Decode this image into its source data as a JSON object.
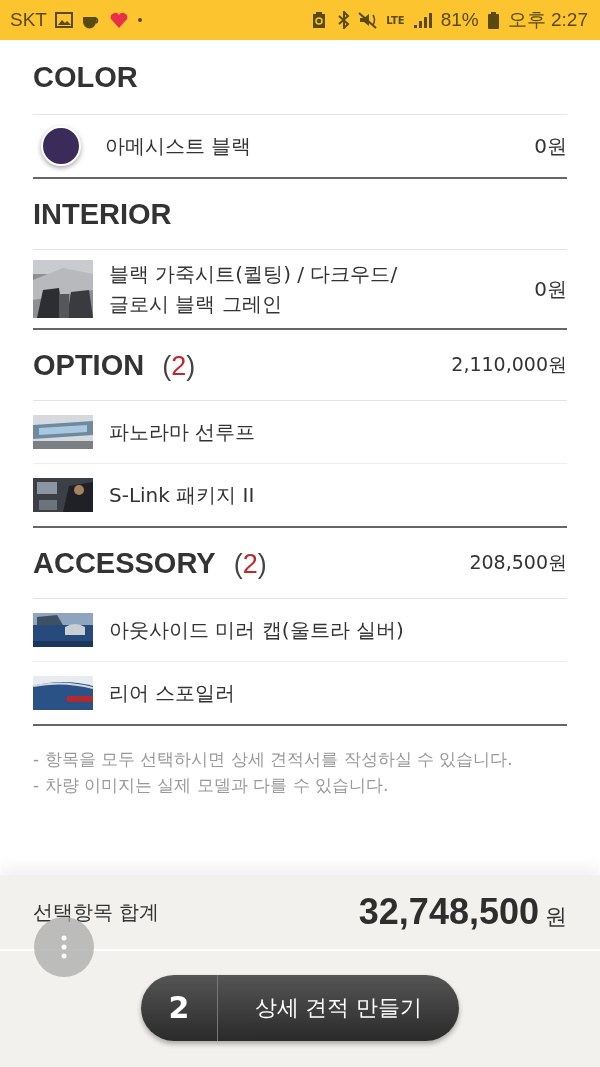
{
  "status_bar": {
    "carrier": "SKT",
    "network": "LTE",
    "battery_percent": "81%",
    "time": "오후 2:27"
  },
  "sections": [
    {
      "title": "COLOR",
      "items": [
        {
          "kind": "swatch",
          "name": "아메시스트 블랙",
          "price": "0원",
          "color": "#3b2b5a"
        }
      ]
    },
    {
      "title": "INTERIOR",
      "items": [
        {
          "kind": "picture",
          "name": "블랙 가죽시트(퀼팅) / 다크우드/ 글로시 블랙 그레인",
          "price": "0원"
        }
      ]
    },
    {
      "title": "OPTION",
      "count": "(**2**)",
      "total": "2,110,000원",
      "items": [
        {
          "kind": "picture",
          "name": "파노라마 선루프"
        },
        {
          "kind": "picture",
          "name": "S-Link 패키지 II"
        }
      ]
    },
    {
      "title": "ACCESSORY",
      "count": "(**2**)",
      "total": "208,500원",
      "items": [
        {
          "kind": "picture",
          "name": "아웃사이드 미러 캡(울트라 실버)"
        },
        {
          "kind": "picture",
          "name": "리어 스포일러"
        }
      ]
    }
  ],
  "notes": [
    "- 항목을 모두 선택하시면 상세 견적서를 작성하실 수 있습니다.",
    "- 차량 이미지는 실제 모델과 다를 수 있습니다."
  ],
  "summary": {
    "label": "선택항목 합계",
    "amount": "32,748,500",
    "unit": "원"
  },
  "action_button": {
    "count": "2",
    "label": "상세 견적 만들기"
  }
}
